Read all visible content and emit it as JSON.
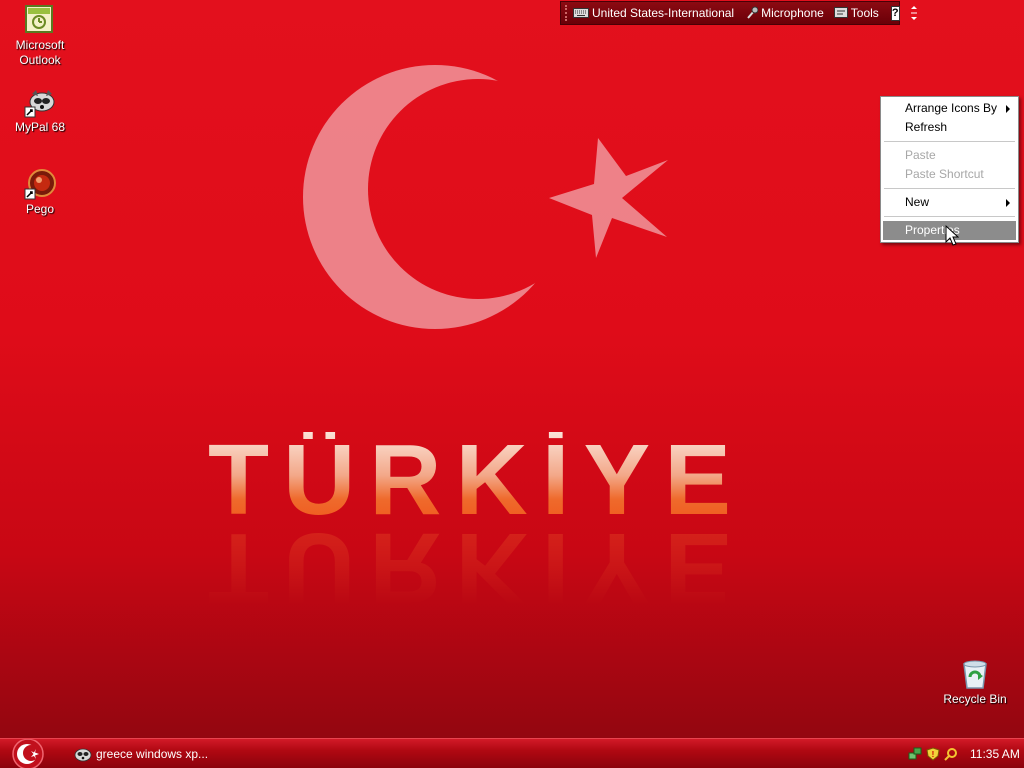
{
  "desktop": {
    "wallpaper_text": "TÜRKİYE",
    "icons": [
      {
        "label_line1": "Microsoft",
        "label_line2": "Outlook",
        "icon": "outlook-icon"
      },
      {
        "label": "MyPal 68",
        "icon": "mypal-icon"
      },
      {
        "label": "Pego",
        "icon": "pego-icon"
      },
      {
        "label": "Recycle Bin",
        "icon": "recycle-bin-icon"
      }
    ]
  },
  "language_bar": {
    "keyboard_layout": "United States-International",
    "microphone_label": "Microphone",
    "tools_label": "Tools",
    "help_label": "?"
  },
  "context_menu": {
    "items": [
      {
        "label": "Arrange Icons By",
        "submenu": true,
        "enabled": true
      },
      {
        "label": "Refresh",
        "enabled": true
      },
      {
        "label": "Paste",
        "enabled": false
      },
      {
        "label": "Paste Shortcut",
        "enabled": false
      },
      {
        "label": "New",
        "submenu": true,
        "enabled": true
      },
      {
        "label": "Properties",
        "enabled": true,
        "selected": true
      }
    ]
  },
  "taskbar": {
    "task_label": "greece windows xp...",
    "clock": "11:35 AM"
  },
  "colors": {
    "wallpaper_red": "#e3101d",
    "taskbar_red": "#b00812",
    "menu_highlight": "#8c8c8c"
  }
}
